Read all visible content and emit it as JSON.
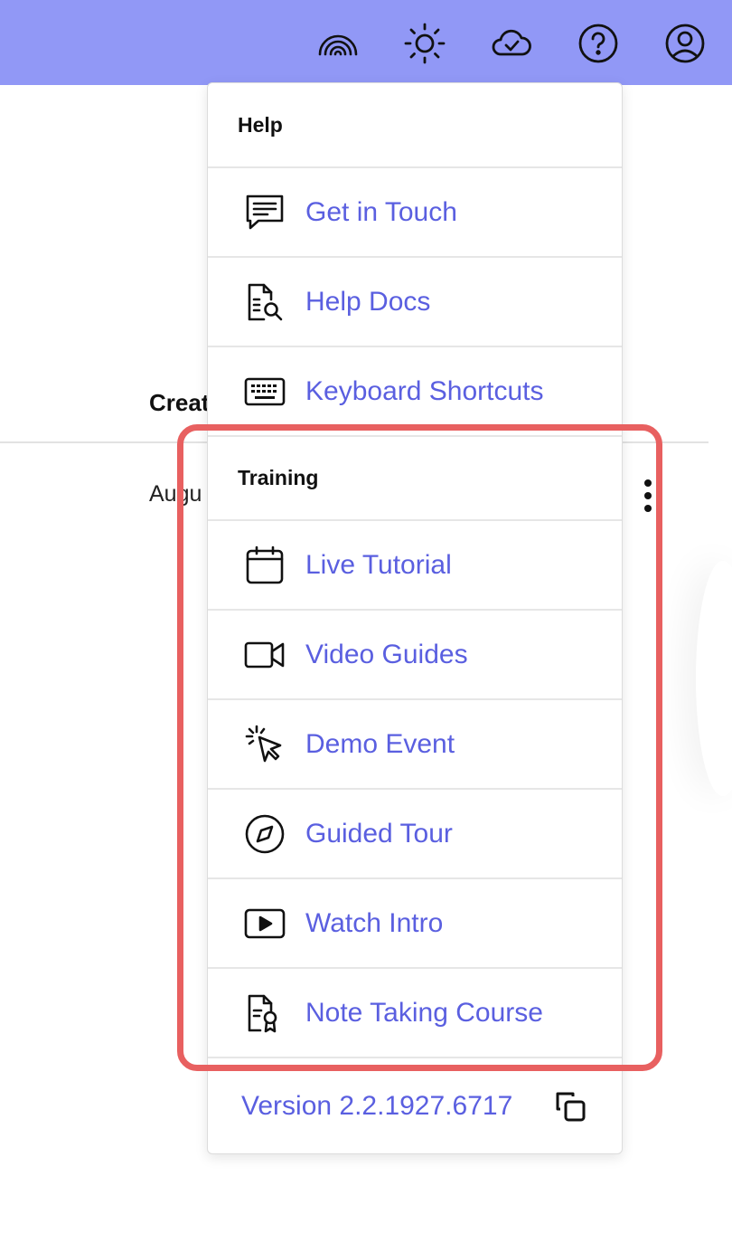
{
  "topbar": {
    "icons": [
      "rainbow-icon",
      "sun-icon",
      "cloud-check-icon",
      "help-circle-icon",
      "user-circle-icon"
    ],
    "background": "#9198f6"
  },
  "background_page": {
    "column_header": "Creat",
    "row_cell": "Augu"
  },
  "menu": {
    "help_section": {
      "title": "Help",
      "items": [
        {
          "label": "Get in Touch",
          "icon": "chat-icon"
        },
        {
          "label": "Help Docs",
          "icon": "doc-search-icon"
        },
        {
          "label": "Keyboard Shortcuts",
          "icon": "keyboard-icon"
        }
      ]
    },
    "training_section": {
      "title": "Training",
      "items": [
        {
          "label": "Live Tutorial",
          "icon": "calendar-icon"
        },
        {
          "label": "Video Guides",
          "icon": "video-camera-icon"
        },
        {
          "label": "Demo Event",
          "icon": "cursor-click-icon"
        },
        {
          "label": "Guided Tour",
          "icon": "compass-icon"
        },
        {
          "label": "Watch Intro",
          "icon": "play-icon"
        },
        {
          "label": "Note Taking Course",
          "icon": "certificate-icon"
        }
      ]
    },
    "version": "Version 2.2.1927.6717"
  },
  "colors": {
    "accent": "#5a5fe0",
    "highlight": "#e86060"
  }
}
